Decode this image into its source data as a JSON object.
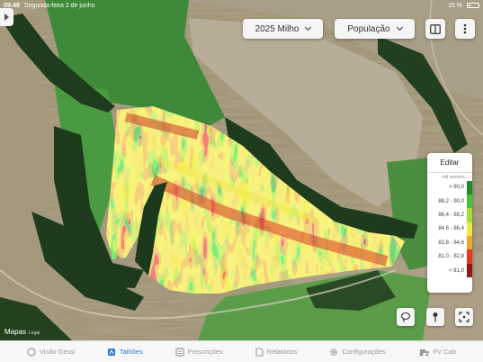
{
  "status": {
    "time": "09:48",
    "date": "Segunda-feira 2 de junho",
    "battery": "16 %"
  },
  "controls": {
    "season_label": "2025 Milho",
    "layer_label": "População"
  },
  "legend": {
    "edit_label": "Editar",
    "unit": "mil semen...",
    "rows": [
      {
        "label": "> 90,0",
        "color": "#1f8a2e"
      },
      {
        "label": "88,2 - 90,0",
        "color": "#46c13a"
      },
      {
        "label": "86,4 - 88,2",
        "color": "#a6dc3c"
      },
      {
        "label": "84,6 - 86,4",
        "color": "#ecec3a"
      },
      {
        "label": "82,8 - 84,6",
        "color": "#f0a82e"
      },
      {
        "label": "81,0 - 82,8",
        "color": "#e53922"
      },
      {
        "label": "< 81,0",
        "color": "#8e1a18"
      }
    ]
  },
  "map": {
    "attribution": "Mapas",
    "legal": "Legal"
  },
  "tabs": [
    {
      "label": "Visão Geral",
      "icon": "overview-icon"
    },
    {
      "label": "Talhões",
      "icon": "fields-icon",
      "active": true
    },
    {
      "label": "Prescrições",
      "icon": "prescriptions-icon"
    },
    {
      "label": "Relatórios",
      "icon": "reports-icon"
    },
    {
      "label": "Configurações",
      "icon": "gear-icon"
    },
    {
      "label": "FV Cab",
      "icon": "tractor-icon"
    }
  ]
}
